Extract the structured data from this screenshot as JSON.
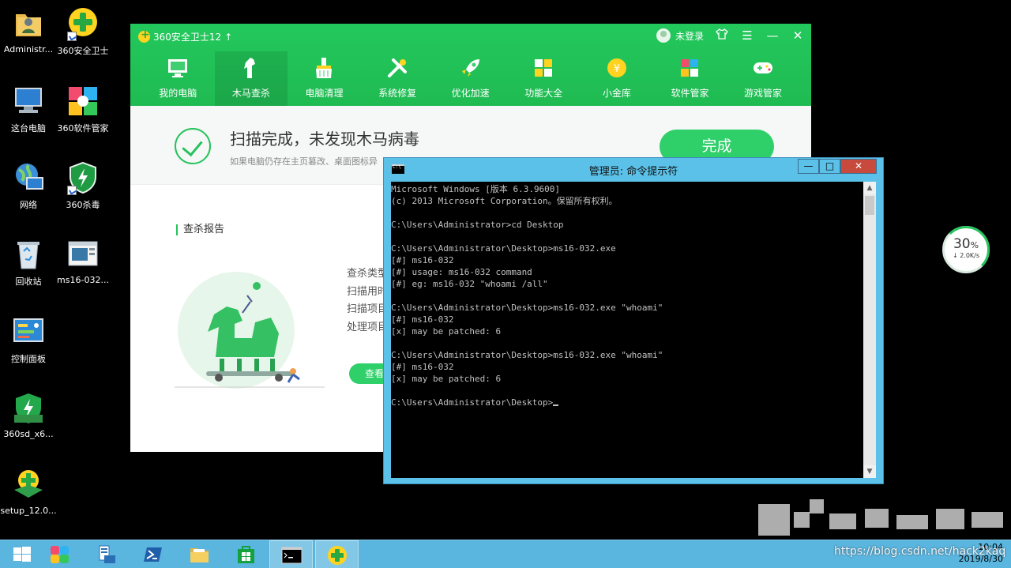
{
  "desktop_icons": [
    {
      "label": "Administr..."
    },
    {
      "label": "360安全卫士"
    },
    {
      "label": "这台电脑"
    },
    {
      "label": "360软件管家"
    },
    {
      "label": "网络"
    },
    {
      "label": "360杀毒"
    },
    {
      "label": "回收站"
    },
    {
      "label": "ms16-032..."
    },
    {
      "label": "控制面板"
    },
    {
      "label": "360sd_x6..."
    },
    {
      "label": "setup_12.0..."
    }
  ],
  "w360": {
    "title": "360安全卫士12",
    "update_arrow": "↑",
    "login_text": "未登录",
    "nav": [
      {
        "label": "我的电脑"
      },
      {
        "label": "木马查杀"
      },
      {
        "label": "电脑清理"
      },
      {
        "label": "系统修复"
      },
      {
        "label": "优化加速"
      },
      {
        "label": "功能大全"
      },
      {
        "label": "小金库"
      },
      {
        "label": "软件管家"
      },
      {
        "label": "游戏管家"
      }
    ],
    "result_title": "扫描完成，未发现木马病毒",
    "result_sub": "如果电脑仍存在主页篡改、桌面图标异",
    "done_label": "完成",
    "report_title": "查杀报告",
    "report_items": [
      "查杀类型",
      "扫描用时",
      "扫描项目",
      "处理项目"
    ],
    "view_label": "查看"
  },
  "cmd": {
    "title": "管理员: 命令提示符",
    "lines": [
      "Microsoft Windows [版本 6.3.9600]",
      "(c) 2013 Microsoft Corporation。保留所有权利。",
      "",
      "C:\\Users\\Administrator>cd Desktop",
      "",
      "C:\\Users\\Administrator\\Desktop>ms16-032.exe",
      "[#] ms16-032",
      "[#] usage: ms16-032 command",
      "[#] eg: ms16-032 \"whoami /all\"",
      "",
      "C:\\Users\\Administrator\\Desktop>ms16-032.exe \"whoami\"",
      "[#] ms16-032",
      "[x] may be patched: 6",
      "",
      "C:\\Users\\Administrator\\Desktop>ms16-032.exe \"whoami\"",
      "[#] ms16-032",
      "[x] may be patched: 6",
      "",
      "C:\\Users\\Administrator\\Desktop>"
    ]
  },
  "speed": {
    "percent": "30",
    "pct_sign": "%",
    "rate": "↓ 2.0K/s"
  },
  "tray": {
    "time": "10:04",
    "date": "2019/8/30"
  },
  "watermark": "https://blog.csdn.net/hack2kaq"
}
